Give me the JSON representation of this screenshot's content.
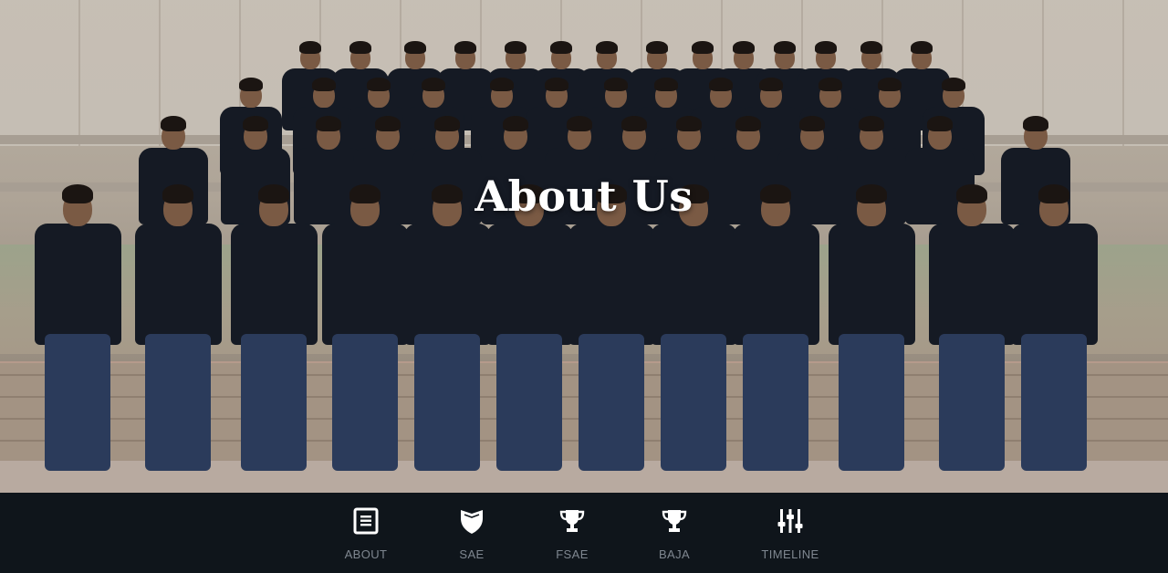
{
  "hero": {
    "title": "About Us",
    "image_alt": "Team group photo seated on a stone bench"
  },
  "navbar": {
    "items": [
      {
        "label": "ABOUT",
        "icon": "document-icon"
      },
      {
        "label": "SAE",
        "icon": "shield-icon"
      },
      {
        "label": "FSAE",
        "icon": "trophy-icon"
      },
      {
        "label": "BAJA",
        "icon": "trophy-icon"
      },
      {
        "label": "TIMELINE",
        "icon": "sliders-icon"
      }
    ]
  },
  "colors": {
    "nav_bg": "#0f151b",
    "nav_label": "#7f8790",
    "icon": "#ffffff",
    "title": "#ffffff"
  }
}
